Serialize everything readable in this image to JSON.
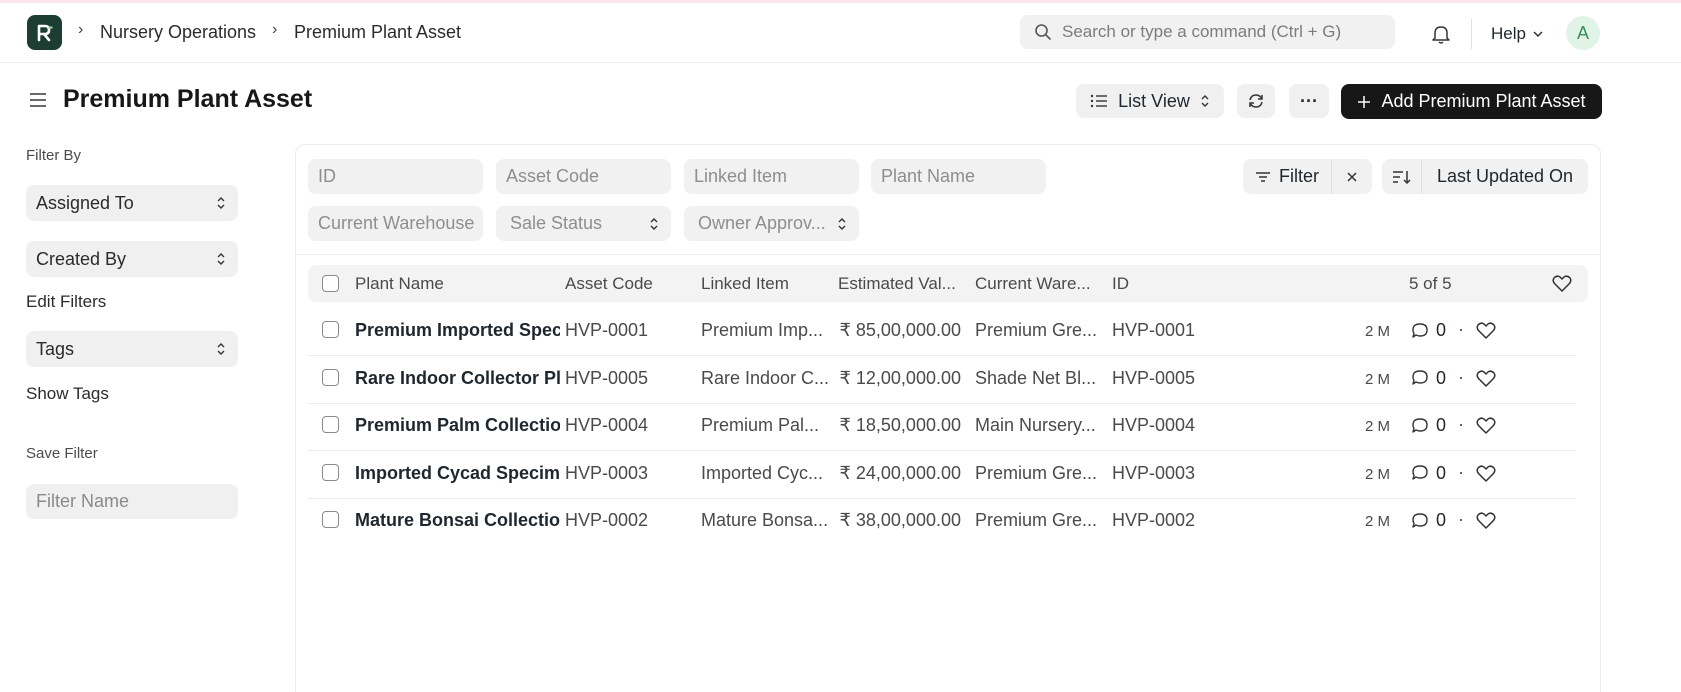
{
  "navbar": {
    "breadcrumbs": [
      "Nursery Operations",
      "Premium Plant Asset"
    ],
    "search_placeholder": "Search or type a command (Ctrl + G)",
    "help_label": "Help",
    "avatar_initial": "A",
    "logo_letter": "R"
  },
  "page": {
    "title": "Premium Plant Asset",
    "view_label": "List View",
    "more_label": "···",
    "add_button": "Add Premium Plant Asset"
  },
  "sidebar": {
    "filter_by": "Filter By",
    "assigned_to": "Assigned To",
    "created_by": "Created By",
    "edit_filters": "Edit Filters",
    "tags": "Tags",
    "show_tags": "Show Tags",
    "save_filter": "Save Filter",
    "filter_name_placeholder": "Filter Name"
  },
  "filters": {
    "id": "ID",
    "asset_code": "Asset Code",
    "linked_item": "Linked Item",
    "plant_name": "Plant Name",
    "current_warehouse": "Current Warehouse",
    "sale_status": "Sale Status",
    "owner_approval": "Owner Approv...",
    "filter_label": "Filter",
    "sort_label": "Last Updated On"
  },
  "table": {
    "headers": {
      "plant_name": "Plant Name",
      "asset_code": "Asset Code",
      "linked_item": "Linked Item",
      "estimated_value": "Estimated Val...",
      "current_warehouse": "Current Ware...",
      "id": "ID"
    },
    "count": "5 of 5",
    "rows": [
      {
        "plant_name": "Premium Imported Specimen",
        "asset_code": "HVP-0001",
        "linked_item": "Premium Imp...",
        "value": "₹ 85,00,000.00",
        "warehouse": "Premium Gre...",
        "id": "HVP-0001",
        "time": "2 M",
        "comments": "0"
      },
      {
        "plant_name": "Rare Indoor Collector Plant",
        "asset_code": "HVP-0005",
        "linked_item": "Rare Indoor C...",
        "value": "₹ 12,00,000.00",
        "warehouse": "Shade Net Bl...",
        "id": "HVP-0005",
        "time": "2 M",
        "comments": "0"
      },
      {
        "plant_name": "Premium Palm Collection",
        "asset_code": "HVP-0004",
        "linked_item": "Premium Pal...",
        "value": "₹ 18,50,000.00",
        "warehouse": "Main Nursery...",
        "id": "HVP-0004",
        "time": "2 M",
        "comments": "0"
      },
      {
        "plant_name": "Imported Cycad Specimen",
        "asset_code": "HVP-0003",
        "linked_item": "Imported Cyc...",
        "value": "₹ 24,00,000.00",
        "warehouse": "Premium Gre...",
        "id": "HVP-0003",
        "time": "2 M",
        "comments": "0"
      },
      {
        "plant_name": "Mature Bonsai Collection",
        "asset_code": "HVP-0002",
        "linked_item": "Mature Bonsa...",
        "value": "₹ 38,00,000.00",
        "warehouse": "Premium Gre...",
        "id": "HVP-0002",
        "time": "2 M",
        "comments": "0"
      }
    ]
  }
}
